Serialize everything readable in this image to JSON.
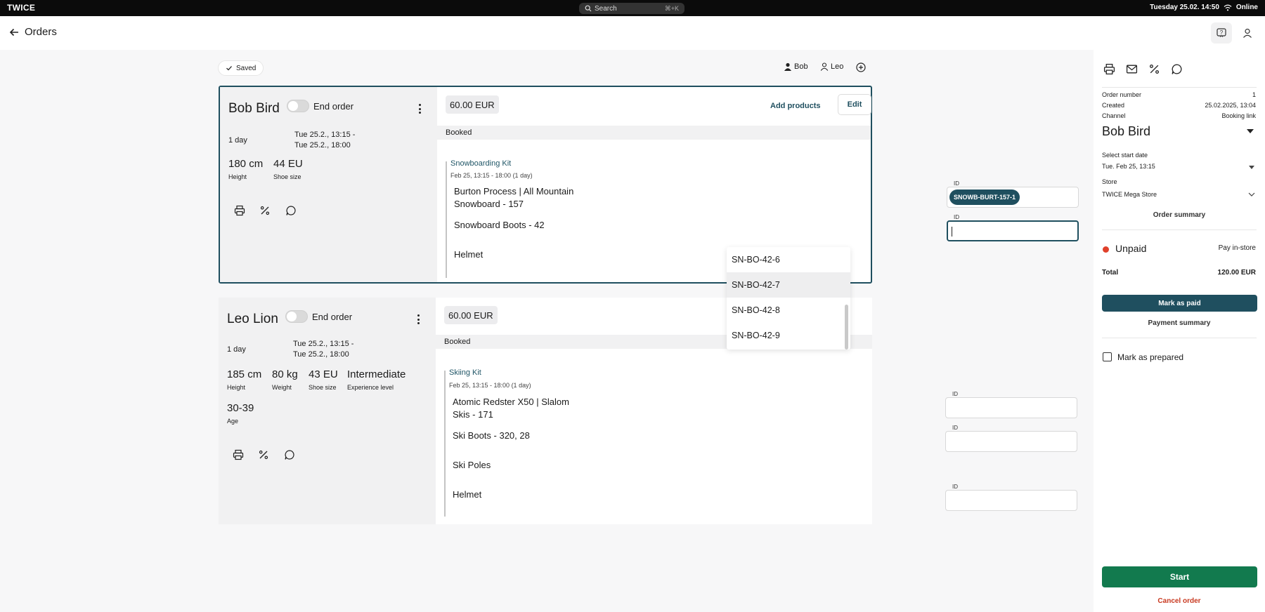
{
  "system_bar": {
    "logo": "TWICE",
    "search_placeholder": "Search",
    "search_shortcut": "⌘+K",
    "datetime": "Tuesday 25.02. 14:50",
    "status": "Online"
  },
  "header": {
    "title": "Orders"
  },
  "saved_badge": "Saved",
  "staff": [
    "Bob",
    "Leo"
  ],
  "orders": [
    {
      "name": "Bob Bird",
      "end_order_label": "End order",
      "duration": "1 day",
      "date_from": "Tue 25.2., 13:15 -",
      "date_to": "Tue 25.2., 18:00",
      "metrics": [
        {
          "value": "180 cm",
          "label": "Height"
        },
        {
          "value": "44 EU",
          "label": "Shoe size"
        }
      ],
      "price": "60.00 EUR",
      "add_products": "Add products",
      "edit": "Edit",
      "status": "Booked",
      "kit": {
        "title": "Snowboarding Kit",
        "date": "Feb 25, 13:15 - 18:00 (1 day)",
        "items": [
          {
            "name_line1": "Burton Process | All Mountain",
            "name_line2": "Snowboard - 157",
            "id_label": "ID",
            "id_value": "SNOWB-BURT-157-1"
          },
          {
            "name_line1": "Snowboard Boots - 42",
            "id_label": "ID",
            "id_value": ""
          },
          {
            "name_line1": "Helmet"
          }
        ]
      }
    },
    {
      "name": "Leo Lion",
      "end_order_label": "End order",
      "duration": "1 day",
      "date_from": "Tue 25.2., 13:15 -",
      "date_to": "Tue 25.2., 18:00",
      "metrics": [
        {
          "value": "185 cm",
          "label": "Height"
        },
        {
          "value": "80 kg",
          "label": "Weight"
        },
        {
          "value": "43 EU",
          "label": "Shoe size"
        },
        {
          "value": "Intermediate",
          "label": "Experience level"
        },
        {
          "value": "30-39",
          "label": "Age"
        }
      ],
      "price": "60.00 EUR",
      "status": "Booked",
      "kit": {
        "title": "Skiing Kit",
        "date": "Feb 25, 13:15 - 18:00 (1 day)",
        "items": [
          {
            "name_line1": "Atomic Redster X50 | Slalom",
            "name_line2": "Skis - 171",
            "id_label": "ID"
          },
          {
            "name_line1": "Ski Boots - 320, 28",
            "id_label": "ID"
          },
          {
            "name_line1": "Ski Poles"
          },
          {
            "name_line1": "Helmet",
            "id_label": "ID"
          }
        ]
      }
    }
  ],
  "dropdown": {
    "options": [
      "SN-BO-42-6",
      "SN-BO-42-7",
      "SN-BO-42-8",
      "SN-BO-42-9"
    ],
    "highlighted_index": 1
  },
  "sidebar": {
    "order_number_label": "Order number",
    "order_number": "1",
    "created_label": "Created",
    "created": "25.02.2025, 13:04",
    "channel_label": "Channel",
    "channel": "Booking link",
    "customer": "Bob Bird",
    "start_date_label": "Select start date",
    "start_date": "Tue. Feb 25, 13:15",
    "store_label": "Store",
    "store": "TWICE Mega Store",
    "order_summary": "Order summary",
    "payment_status": "Unpaid",
    "payment_method": "Pay in-store",
    "total_label": "Total",
    "total": "120.00 EUR",
    "mark_paid": "Mark as paid",
    "payment_summary": "Payment summary",
    "mark_prepared": "Mark as prepared",
    "start": "Start",
    "cancel": "Cancel order"
  },
  "colors": {
    "accent": "#1f4f5f",
    "start": "#127a4e",
    "unpaid": "#e0412b",
    "cancel": "#c8381f"
  }
}
